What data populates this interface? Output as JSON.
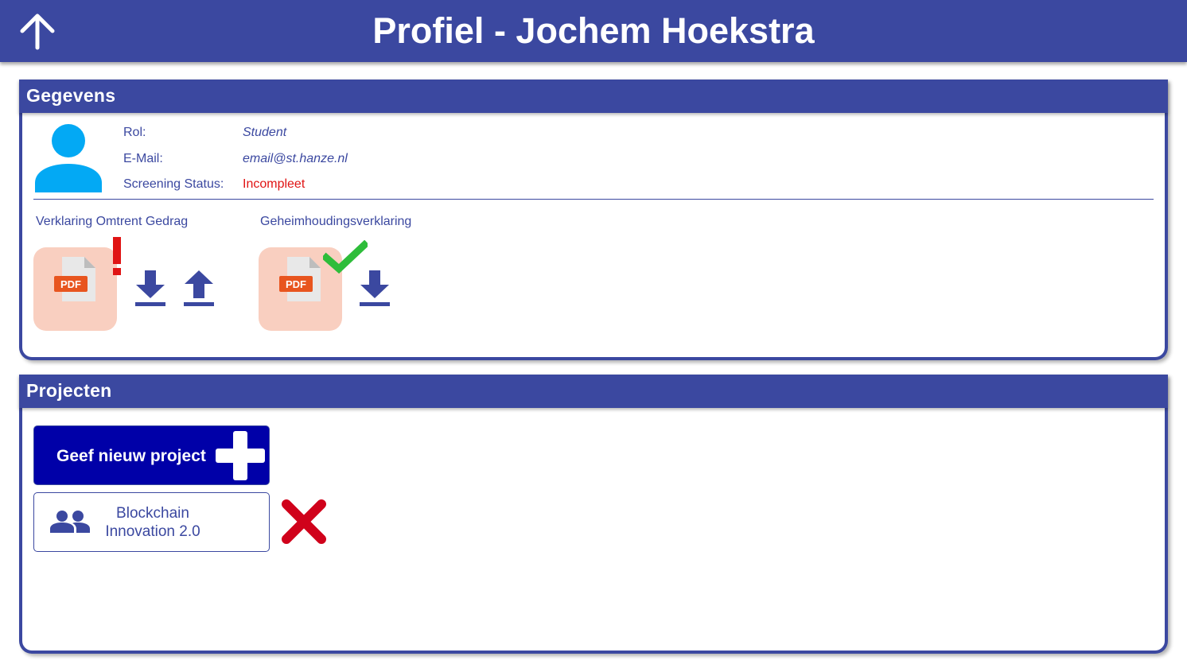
{
  "header": {
    "title": "Profiel - Jochem Hoekstra",
    "back_icon": "arrow-up-icon"
  },
  "gegevens": {
    "title": "Gegevens",
    "avatar_icon": "person-icon",
    "fields": [
      {
        "label": "Rol:",
        "value": "Student"
      },
      {
        "label": "E-Mail:",
        "value": "email@st.hanze.nl"
      },
      {
        "label": "Screening Status:",
        "value": "Incompleet"
      }
    ],
    "documents": [
      {
        "label": "Verklaring Omtrent Gedrag",
        "file_badge": "PDF",
        "status_icon": "exclamation-icon",
        "actions": [
          "download-icon",
          "upload-icon"
        ]
      },
      {
        "label": "Geheimhoudingsverklaring",
        "file_badge": "PDF",
        "status_icon": "checkmark-icon",
        "actions": [
          "download-icon"
        ]
      }
    ]
  },
  "projecten": {
    "title": "Projecten",
    "new_project_label": "Geef nieuw project",
    "projects": [
      {
        "name": "Blockchain Innovation 2.0",
        "icon": "group-icon",
        "remove_icon": "remove-x-icon"
      }
    ]
  },
  "colors": {
    "primary": "#3b48a0",
    "button": "#0000a8",
    "status_incomplete": "#e01414",
    "success": "#2ebd3a",
    "pdf_tile": "#f9cfc0",
    "avatar": "#03a9f4",
    "remove": "#d0021b"
  }
}
